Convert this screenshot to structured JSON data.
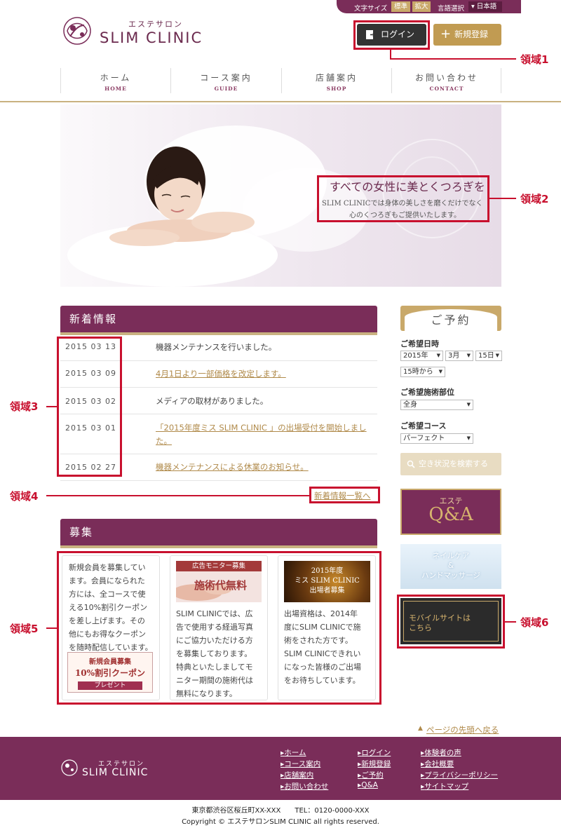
{
  "util": {
    "font_size_label": "文字サイズ",
    "font_standard": "標準",
    "font_large": "拡大",
    "lang_label": "言語選択",
    "lang_value": "日本語"
  },
  "logo": {
    "small": "エステサロン",
    "main": "SLIM CLINIC"
  },
  "header": {
    "login": "ログイン",
    "register": "新規登録"
  },
  "annotations": {
    "a1": "領域1",
    "a2": "領域2",
    "a3": "領域3",
    "a4": "領域4",
    "a5": "領域5",
    "a6": "領域6"
  },
  "nav": [
    {
      "jp": "ホーム",
      "en": "HOME"
    },
    {
      "jp": "コース案内",
      "en": "GUIDE"
    },
    {
      "jp": "店舗案内",
      "en": "SHOP"
    },
    {
      "jp": "お問い合わせ",
      "en": "CONTACT"
    }
  ],
  "hero": {
    "title": "すべての女性に美とくつろぎを",
    "sub1": "SLIM CLINICでは身体の美しさを磨くだけでなく",
    "sub2": "心のくつろぎもご提供いたします。"
  },
  "news": {
    "title": "新着情報",
    "items": [
      {
        "date": "2015 03 13",
        "text": "機器メンテナンスを行いました。"
      },
      {
        "date": "2015 03 09",
        "text": "4月1日より一部価格を改定します。"
      },
      {
        "date": "2015 03 02",
        "text": "メディアの取材がありました。"
      },
      {
        "date": "2015 03 01",
        "text": "「2015年度ミス SLIM CLINIC 」の出場受付を開始しました。"
      },
      {
        "date": "2015 02 27",
        "text": "機器メンテナンスによる休業のお知らせ。"
      }
    ],
    "more": "新着情報一覧へ"
  },
  "recruit": {
    "title": "募集",
    "card1_lines": [
      "新規会員を募集してい",
      "ます。会員になられた",
      "方には、全コースで使",
      "える10%割引クーポン",
      "を差し上げます。その",
      "他にもお得なクーポン",
      "を随時配信しています。"
    ],
    "card1_banner": {
      "head": "新規会員募集",
      "main": "10%割引クーポン",
      "foot": "プレゼント"
    },
    "card2_img": {
      "head": "広告モニター募集",
      "main": "施術代無料"
    },
    "card2_lines": [
      "SLIM CLINICでは、広",
      "告で使用する経過写真",
      "にご協力いただける方",
      "を募集しております。",
      "特典といたしましてモ",
      "ニター期間の施術代は",
      "無料になります。"
    ],
    "card3_img": {
      "line1": "2015年度",
      "line2": "ミス SLIM CLINIC",
      "line3": "出場者募集"
    },
    "card3_lines": [
      "出場資格は、2014年",
      "度にSLIM CLINICで施",
      "術をされた方です。",
      "SLIM CLINICできれい",
      "になった皆様のご出場",
      "をお待ちしています。"
    ]
  },
  "reserve": {
    "title": "ご予約",
    "date_label": "ご希望日時",
    "year": "2015年",
    "month": "3月",
    "day": "15日",
    "time": "15時から",
    "part_label": "ご希望施術部位",
    "part": "全身",
    "course_label": "ご希望コース",
    "course": "パーフェクト",
    "search": "空き状況を検索する"
  },
  "side_banners": {
    "qa_small": "エステ",
    "qa_main": "Q&A",
    "nail1": "ネイルケア",
    "nail2": "&",
    "nail3": "ハンドマッサージ",
    "mobile1": "モバイルサイトは",
    "mobile2": "こちら"
  },
  "footer": {
    "pagetop": "ページの先頭へ戻る",
    "col1": [
      "ホーム",
      "コース案内",
      "店舗案内",
      "お問い合わせ"
    ],
    "col2": [
      "ログイン",
      "新規登録",
      "ご予約",
      "Q&A"
    ],
    "col3": [
      "体験者の声",
      "会社概要",
      "プライバシーポリシー",
      "サイトマップ"
    ],
    "address": "東京都渋谷区桜丘町XX-XXX　　TEL：0120-0000-XXX",
    "copyright": "Copyright © エステサロンSLIM CLINIC all rights reserved."
  }
}
